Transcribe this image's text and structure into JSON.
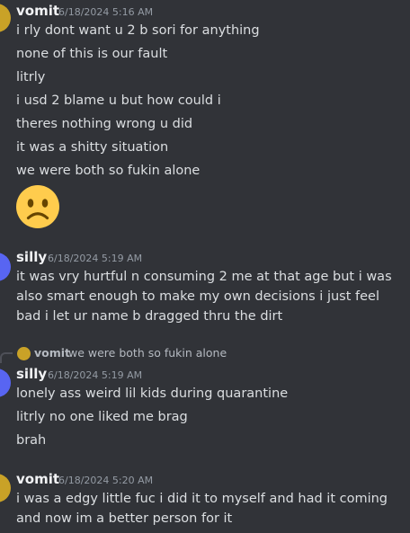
{
  "messages": [
    {
      "author": "vomit",
      "timestamp": "6/18/2024 5:16 AM",
      "lines": [
        "i rly dont want u 2 b sori for anything",
        "none of this is our fault",
        "litrly",
        "i usd 2 blame u but how could i",
        "theres nothing wrong u did",
        "it was a shitty situation",
        "we were both so fukin alone"
      ],
      "emoji": "frowning-face"
    },
    {
      "author": "silly",
      "timestamp": "6/18/2024 5:19 AM",
      "lines": [
        "it was vry hurtful n consuming 2 me at that age but i was also smart enough to make my own decisions i just feel bad i let ur name b dragged thru the dirt"
      ]
    },
    {
      "reply": {
        "author": "vomit",
        "text": "we were both so fukin alone"
      },
      "author": "silly",
      "timestamp": "6/18/2024 5:19 AM",
      "lines": [
        "lonely ass weird lil kids during quarantine",
        "litrly no one liked me brag",
        "brah"
      ]
    },
    {
      "author": "vomit",
      "timestamp": "6/18/2024 5:20 AM",
      "lines": [
        "i was a edgy little fuc i did it to myself and had it coming and now im a better person for it"
      ]
    }
  ],
  "colors": {
    "background": "#313338",
    "username": "#f2f3f5",
    "timestamp": "#949ba4",
    "text": "#dbdee1",
    "reply_line": "#4e5058"
  }
}
